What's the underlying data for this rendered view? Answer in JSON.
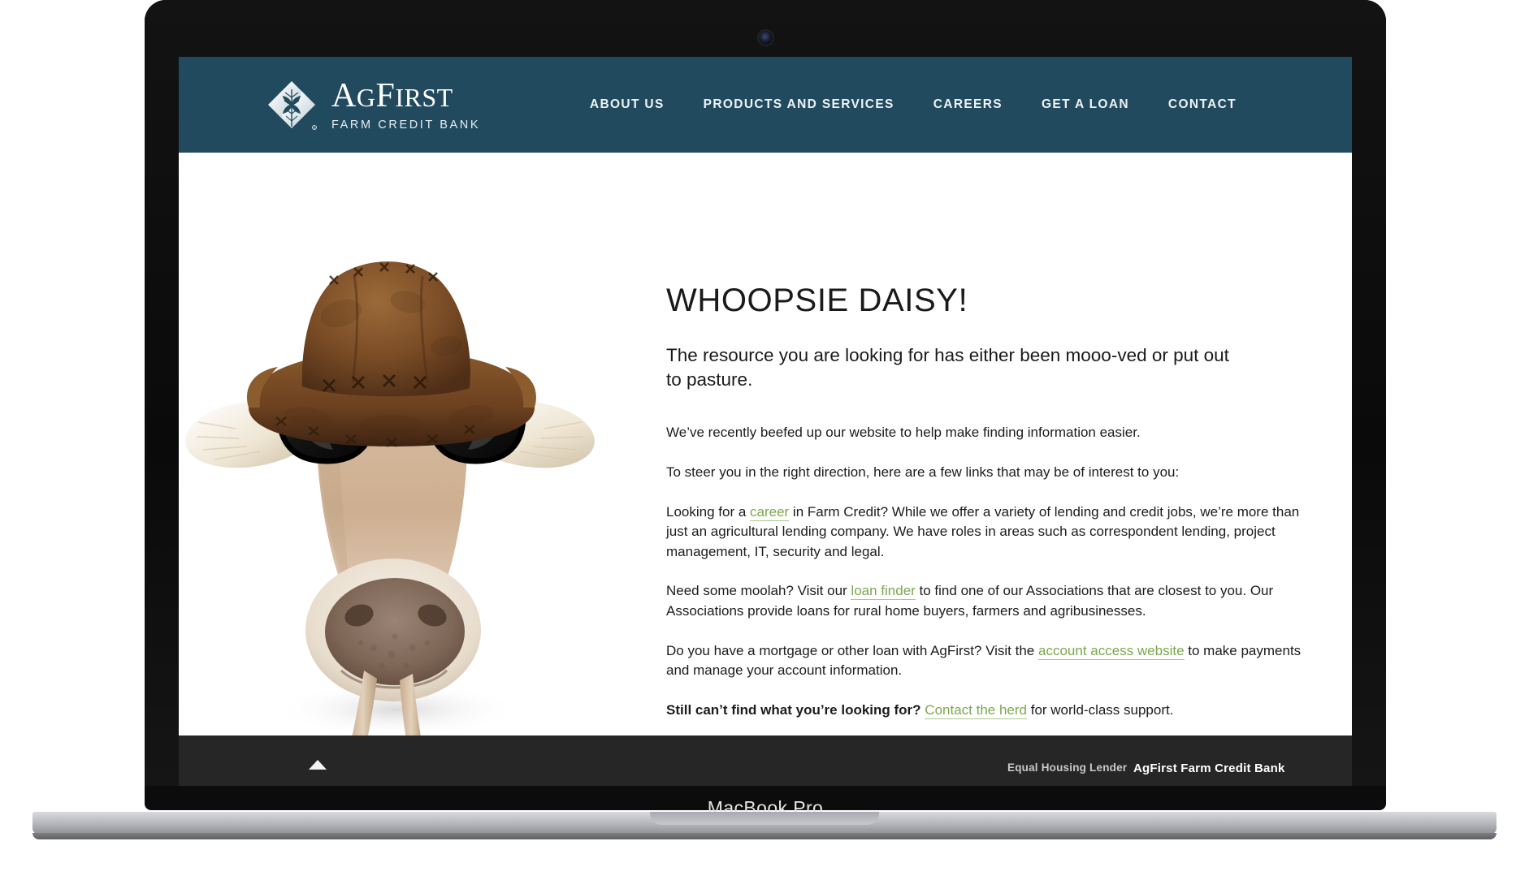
{
  "device": {
    "label": "MacBook Pro",
    "webcam_icon": "webcam-icon"
  },
  "header": {
    "background_color": "#214a5f",
    "brand": {
      "logo_icon": "agfirst-diamond-leaf-logo",
      "name_part1": "A",
      "name_part2": "G",
      "name_part3": "F",
      "name_part4": "IRST",
      "name_full": "AgFirst",
      "tagline": "FARM CREDIT BANK"
    },
    "nav": [
      {
        "label": "ABOUT US",
        "name": "nav-about-us"
      },
      {
        "label": "PRODUCTS AND SERVICES",
        "name": "nav-products-and-services"
      },
      {
        "label": "CAREERS",
        "name": "nav-careers"
      },
      {
        "label": "GET A LOAN",
        "name": "nav-get-a-loan"
      },
      {
        "label": "CONTACT",
        "name": "nav-contact"
      }
    ]
  },
  "main": {
    "hero_image_alt": "cow-wearing-cowboy-hat-and-sunglasses",
    "title": "WHOOPSIE DAISY!",
    "lede": "The resource you are looking for has either been mooo-ved or put out to pasture.",
    "paragraphs": {
      "p1": "We’ve recently beefed up our website to help make finding information easier.",
      "p2": "To steer you in the right direction, here are a few links that may be of interest to you:",
      "p3_before": "Looking for a ",
      "p3_link": "career",
      "p3_after": " in Farm Credit? While we offer a variety of lending and credit jobs, we’re more than just an agricultural lending company. We have roles in areas such as correspondent lending, project management, IT, security and legal.",
      "p4_before": "Need some moolah? Visit our ",
      "p4_link": "loan finder",
      "p4_after": " to find one of our Associations that are closest to you. Our Associations provide loans for rural home buyers, farmers and agribusinesses.",
      "p5_before": "Do you have a mortgage or other loan with AgFirst? Visit the ",
      "p5_link": "account access website",
      "p5_after": " to make payments and manage your account information.",
      "p6_bold": "Still can’t find what you’re looking for?",
      "p6_link": "Contact the herd",
      "p6_after": " for world-class support."
    },
    "link_color": "#7ba84e"
  },
  "footer": {
    "scroll_top_icon": "scroll-to-top-arrow-icon",
    "equal_housing_lender": "Equal Housing Lender",
    "brand": "AgFirst Farm Credit Bank",
    "background_color": "#262626"
  }
}
